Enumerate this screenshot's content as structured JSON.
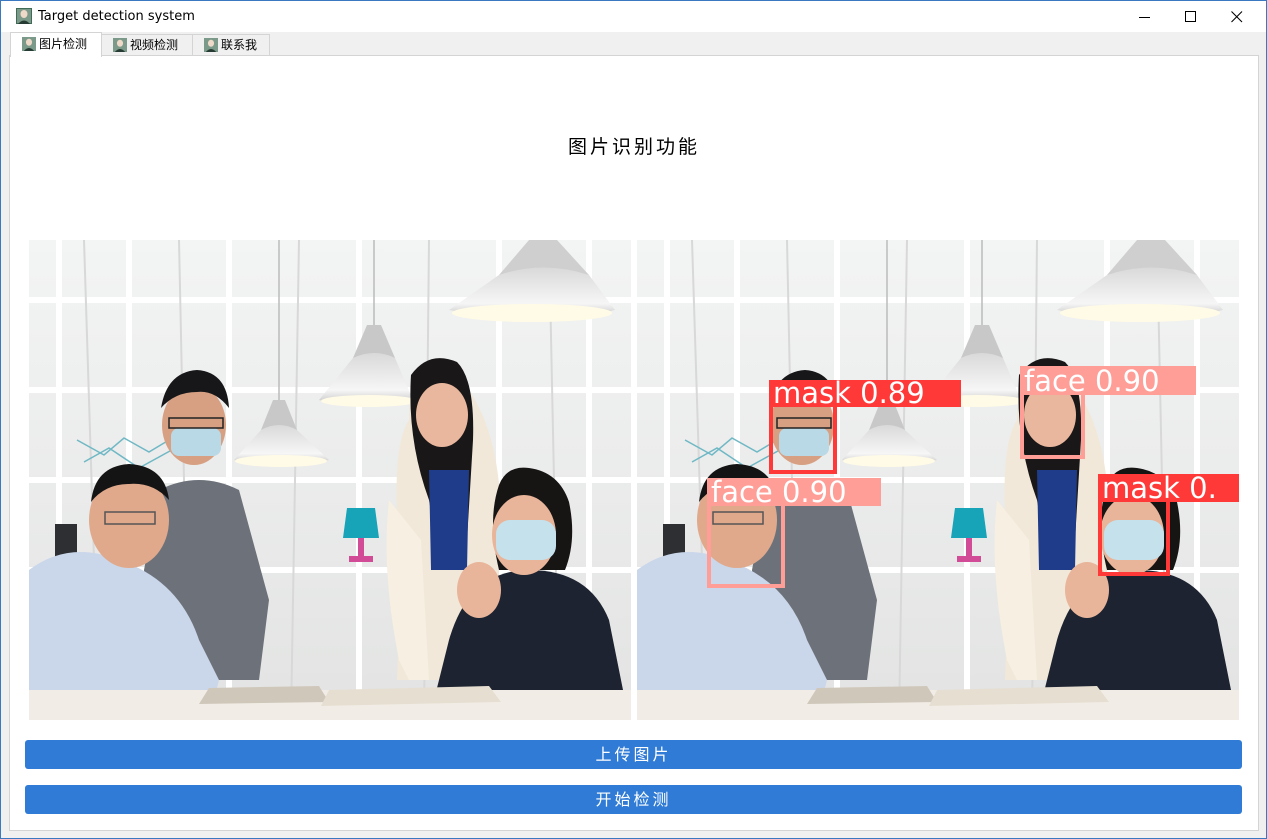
{
  "window": {
    "title": "Target detection system",
    "controls": [
      "minimize-icon",
      "maximize-icon",
      "close-icon"
    ]
  },
  "tabs": [
    {
      "label": "图片检测",
      "active": true
    },
    {
      "label": "视频检测",
      "active": false
    },
    {
      "label": "联系我",
      "active": false
    }
  ],
  "main": {
    "heading": "图片识别功能",
    "images": {
      "original": "",
      "result": ""
    },
    "detections": [
      {
        "label": "mask 0.89",
        "class": "mask",
        "confidence": 0.89
      },
      {
        "label": "face 0.90",
        "class": "face",
        "confidence": 0.9
      },
      {
        "label": "face 0.90",
        "class": "face",
        "confidence": 0.9
      },
      {
        "label": "mask 0.",
        "class": "mask",
        "confidence": null
      }
    ],
    "buttons": {
      "upload": "上传图片",
      "detect": "开始检测"
    }
  },
  "colors": {
    "accent": "#2f7bd5",
    "mask_box": "#ff3838",
    "face_box": "#ff9d97",
    "desktop": "#2b6cb5"
  }
}
